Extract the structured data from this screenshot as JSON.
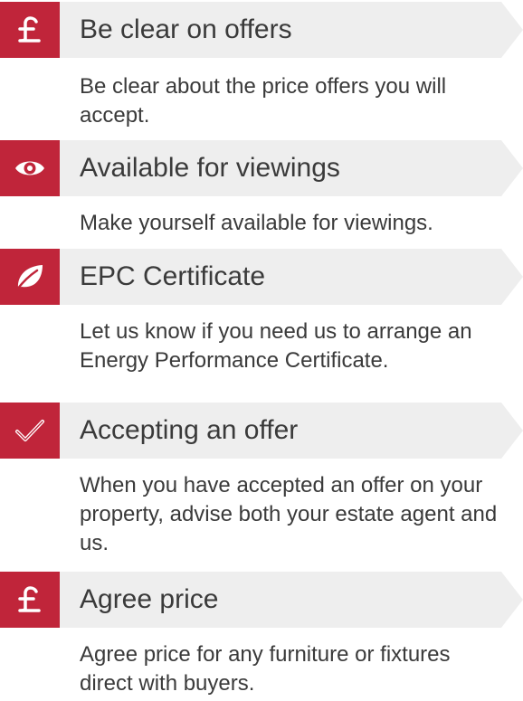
{
  "colors": {
    "accent": "#c0253a",
    "header_background": "#eeeeee",
    "text": "#3a3a3a"
  },
  "steps": [
    {
      "icon": "pound-sign-icon",
      "title": "Be clear on offers",
      "description": "Be clear about the price offers you will accept."
    },
    {
      "icon": "eye-icon",
      "title": "Available for viewings",
      "description": "Make yourself available for viewings."
    },
    {
      "icon": "leaf-icon",
      "title": "EPC Certificate",
      "description": "Let us know if you need us to arrange an Energy Performance Certificate."
    },
    {
      "icon": "checkmark-icon",
      "title": "Accepting an offer",
      "description": "When you have accepted an offer on your property, advise both your estate agent and us."
    },
    {
      "icon": "pound-sign-icon",
      "title": "Agree price",
      "description": "Agree price for any furniture or fixtures direct with buyers."
    }
  ]
}
